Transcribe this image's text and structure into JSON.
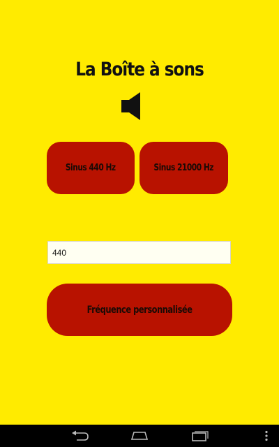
{
  "app": {
    "title": "La Boîte à sons",
    "speaker_icon": "speaker-icon"
  },
  "buttons": {
    "sine_440_label": "Sinus 440 Hz",
    "sine_21000_label": "Sinus 21000 Hz",
    "custom_label": "Fréquence personnalisée"
  },
  "frequency_input": {
    "value": "440"
  },
  "navbar": {
    "back_icon": "back-icon",
    "home_icon": "home-icon",
    "recent_icon": "recent-apps-icon",
    "menu_icon": "overflow-menu-icon"
  },
  "colors": {
    "background": "#FFEB00",
    "button": "#B81200",
    "input_background": "#FFFFF2",
    "navbar": "#000000"
  }
}
